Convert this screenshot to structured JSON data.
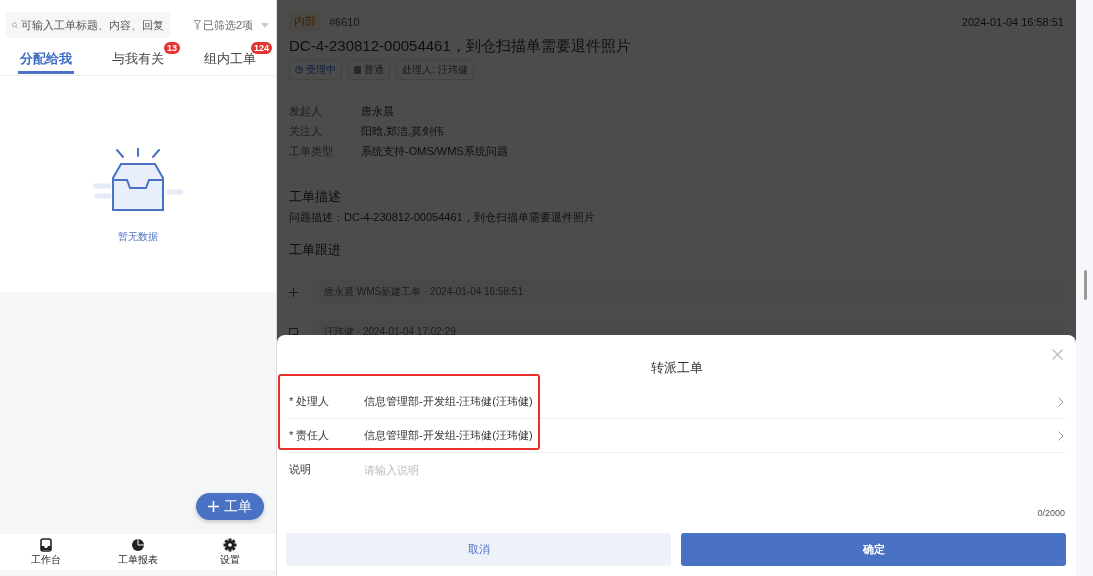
{
  "search": {
    "placeholder": "可输入工单标题、内容、回复"
  },
  "filter": {
    "label": "已筛选2项"
  },
  "tabs": [
    {
      "label": "分配给我",
      "selected": true
    },
    {
      "label": "与我有关",
      "selected": false,
      "badge": "13"
    },
    {
      "label": "组内工单",
      "selected": false,
      "badge": "124"
    }
  ],
  "empty": {
    "text": "暂无数据"
  },
  "fab": {
    "label": "工单"
  },
  "nav": [
    {
      "label": "工作台"
    },
    {
      "label": "工单报表"
    },
    {
      "label": "设置"
    }
  ],
  "detail": {
    "tag": "内部",
    "number": "#6610",
    "time": "2024-01-04 16:58:51",
    "title": "DC-4-230812-00054461，到仓扫描单需要退件照片",
    "chips": [
      {
        "label": "受理中",
        "kind": "status"
      },
      {
        "label": "普通",
        "kind": "priority"
      },
      {
        "label": "处理人: 汪玮健",
        "kind": "plain"
      }
    ],
    "fields": [
      {
        "label": "发起人",
        "value": "唐永晨"
      },
      {
        "label": "关注人",
        "value": "阳晗,郑洁,莫剑伟"
      },
      {
        "label": "工单类型",
        "value": "系统支持-OMS/WMS系统问题"
      }
    ],
    "description": {
      "heading": "工单描述",
      "text": "问题描述：DC-4-230812-00054461，到仓扫描单需要退件照片"
    },
    "followup": {
      "heading": "工单跟进",
      "entries": [
        {
          "kind": "create",
          "text": "唐永晨 WMS新建工单 · 2024-01-04 16:58:51"
        },
        {
          "kind": "comment",
          "text": "汪玮健 · 2024-01-04 17:02:29"
        }
      ]
    }
  },
  "sheet": {
    "title": "转派工单",
    "rows": [
      {
        "kind": "select",
        "label": "* 处理人",
        "value": "信息管理部-开发组-汪玮健(汪玮健)"
      },
      {
        "kind": "select",
        "label": "* 责任人",
        "value": "信息管理部-开发组-汪玮健(汪玮健)"
      },
      {
        "kind": "text",
        "label": "说明",
        "placeholder": "请输入说明"
      }
    ],
    "counter": "0/2000",
    "buttons": [
      {
        "label": "取消",
        "kind": "secondary"
      },
      {
        "label": "确定",
        "kind": "primary"
      }
    ]
  }
}
